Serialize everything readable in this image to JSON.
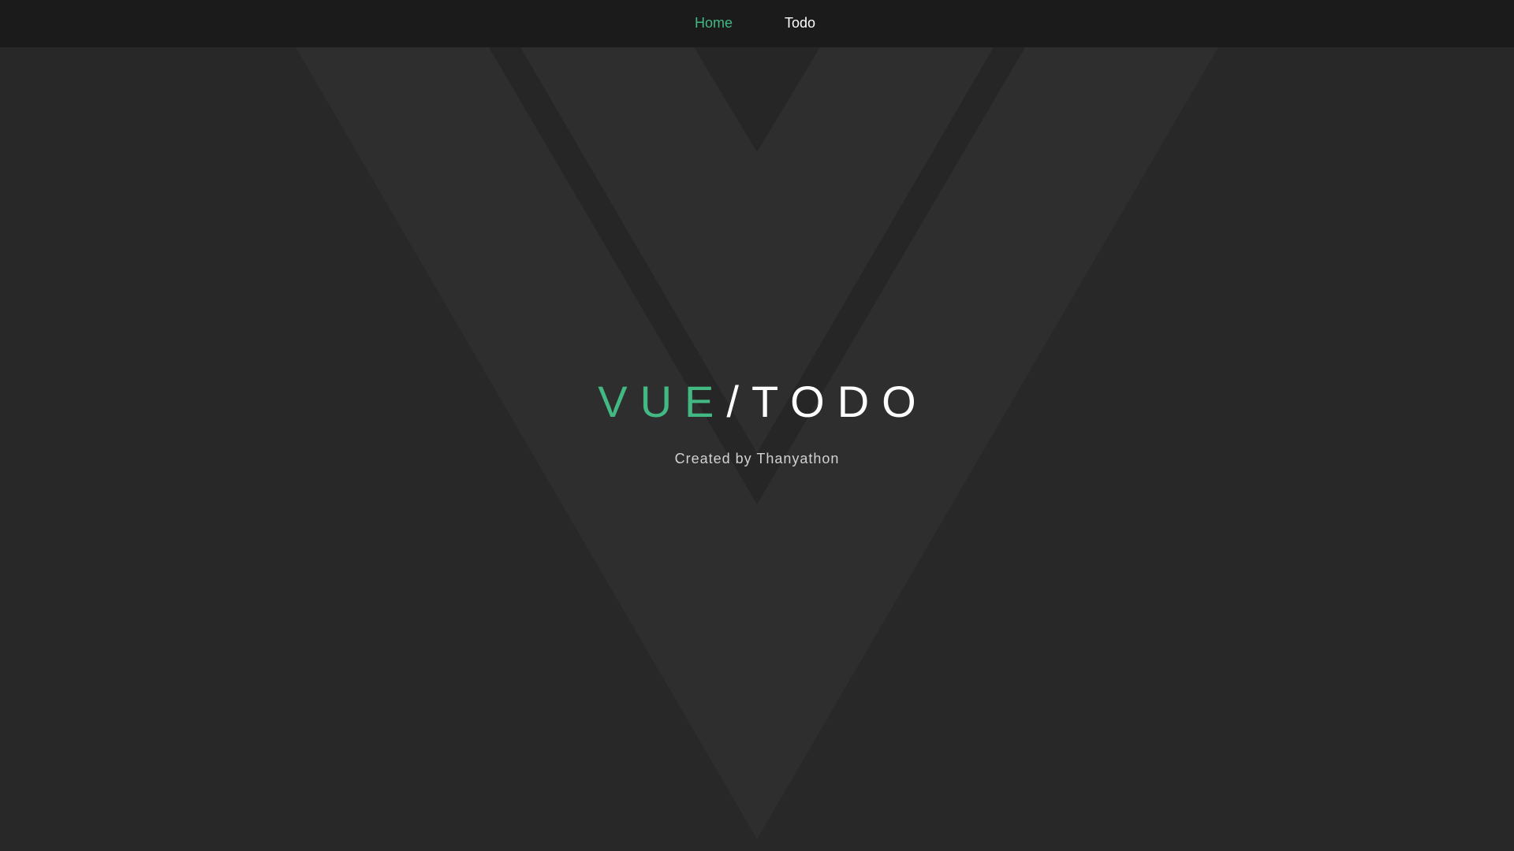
{
  "nav": {
    "links": [
      {
        "label": "Home",
        "active": true
      },
      {
        "label": "Todo",
        "active": false
      }
    ]
  },
  "hero": {
    "title_vue": "VUE",
    "title_sep": "/",
    "title_todo": "TODO",
    "credit": "Created by Thanyathon"
  },
  "background": {
    "logo": "vue-logo-watermark"
  },
  "colors": {
    "accent": "#42b883",
    "nav_bg": "#1b1b1b",
    "page_bg": "#282828",
    "text": "#ffffff"
  }
}
